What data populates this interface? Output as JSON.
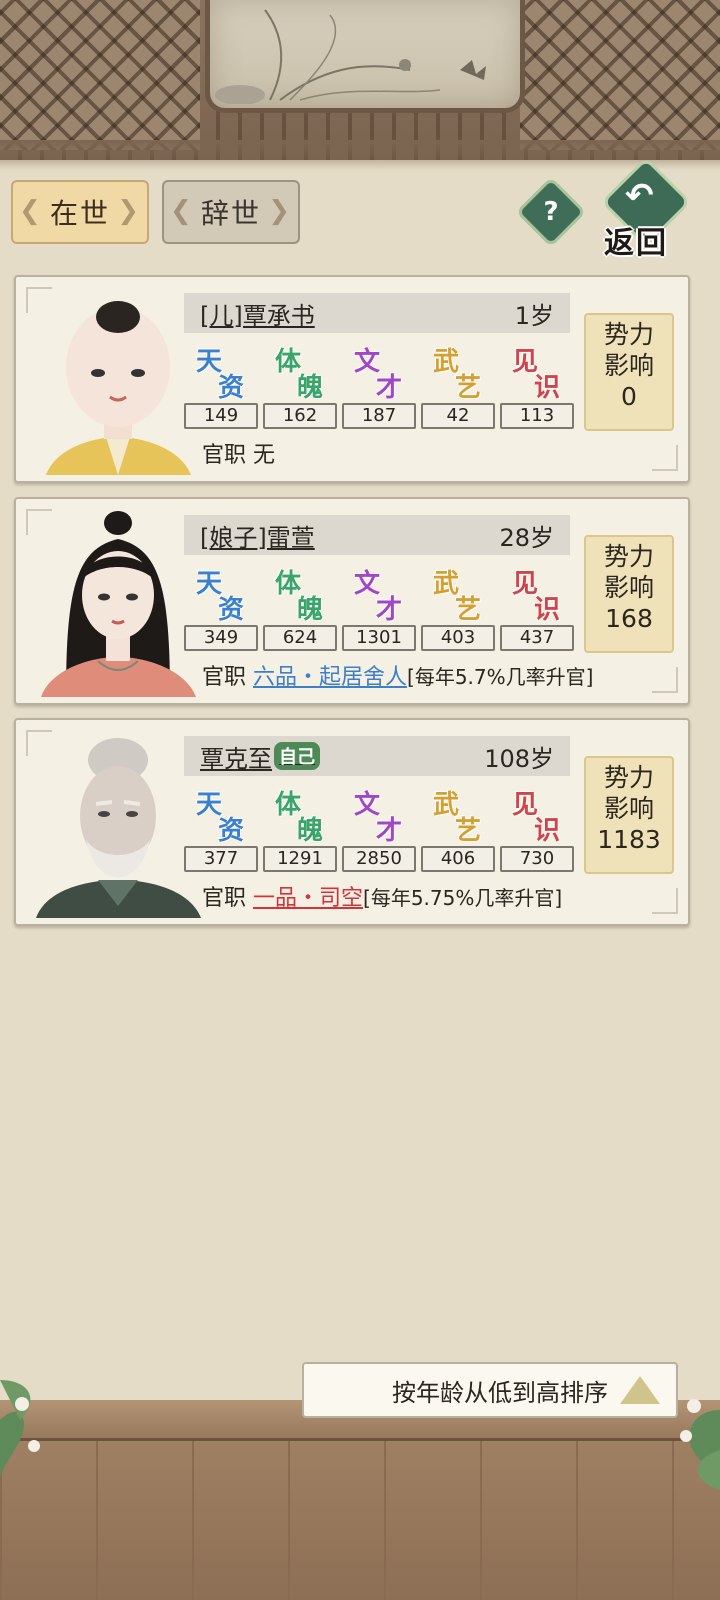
{
  "tabs": {
    "alive": "在世",
    "deceased": "辞世"
  },
  "help_label": "?",
  "back_label": "返回",
  "stat_names": [
    [
      "天",
      "资"
    ],
    [
      "体",
      "魄"
    ],
    [
      "文",
      "才"
    ],
    [
      "武",
      "艺"
    ],
    [
      "见",
      "识"
    ]
  ],
  "stat_colors": [
    "#3a7fd0",
    "#3aa56a",
    "#a246c8",
    "#d4a032",
    "#d0454b"
  ],
  "influence_lines": [
    "势力",
    "影响"
  ],
  "office_label": "官职",
  "members": [
    {
      "name": "[儿]覃承书",
      "age": "1岁",
      "self_badge": "",
      "stats": [
        "149",
        "162",
        "187",
        "42",
        "113"
      ],
      "influence": "0",
      "office_rank": "",
      "office_plain": "无",
      "office_note": ""
    },
    {
      "name": "[娘子]雷萱",
      "age": "28岁",
      "self_badge": "",
      "stats": [
        "349",
        "624",
        "1301",
        "403",
        "437"
      ],
      "influence": "168",
      "office_rank": "六品・起居舍人",
      "office_plain": "",
      "office_note": "[每年5.7%几率升官]"
    },
    {
      "name": "覃克至",
      "age": "108岁",
      "self_badge": "自己",
      "stats": [
        "377",
        "1291",
        "2850",
        "406",
        "730"
      ],
      "influence": "1183",
      "office_rank": "一品・司空",
      "office_plain": "",
      "office_note": "[每年5.75%几率升官]"
    }
  ],
  "sort_label": "按年龄从低到高排序"
}
